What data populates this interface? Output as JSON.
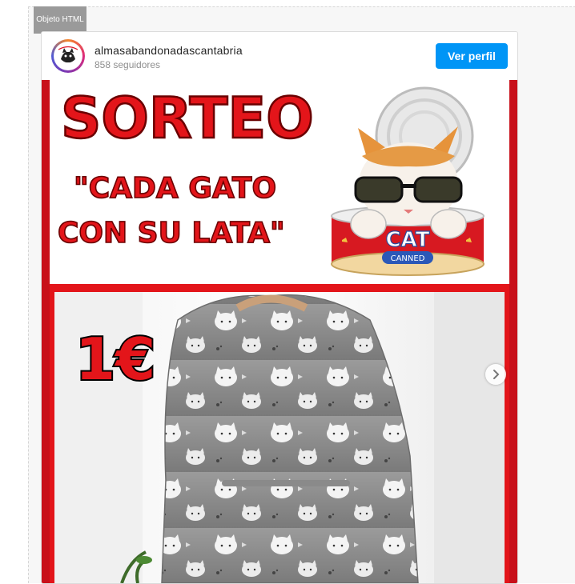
{
  "object_label": "Objeto HTML",
  "profile": {
    "username": "almasabandonadascantabria",
    "followers": "858 seguidores",
    "view_profile_label": "Ver perfil"
  },
  "post": {
    "title": "SORTEO",
    "subtitle_line1": "\"CADA GATO",
    "subtitle_line2": "CON SU LATA\"",
    "can_label": "CAT",
    "can_sublabel": "CANNED",
    "price": "1€"
  },
  "colors": {
    "accent": "#0095f6",
    "poster_red": "#e3151a",
    "poster_border": "#c8101a"
  }
}
